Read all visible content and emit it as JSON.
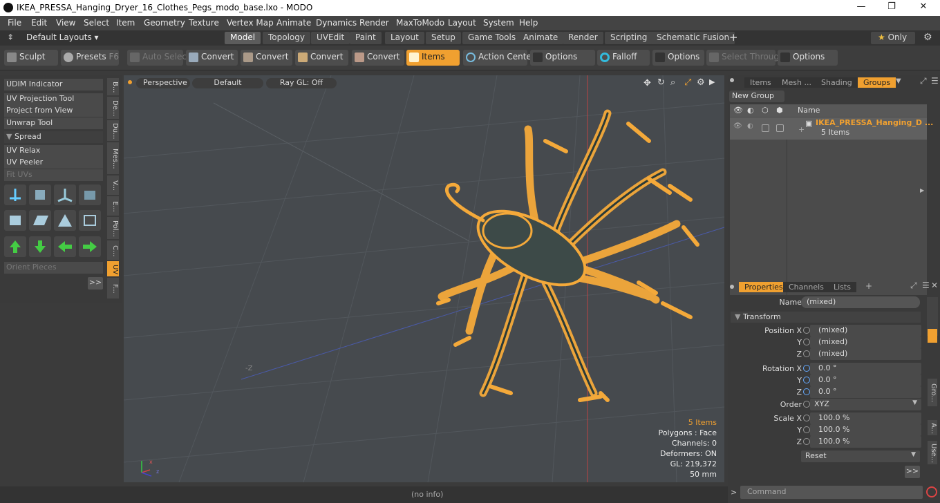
{
  "titlebar": {
    "title": "IKEA_PRESSA_Hanging_Dryer_16_Clothes_Pegs_modo_base.lxo - MODO",
    "minimize": "—",
    "maximize": "❐",
    "close": "✕"
  },
  "menu": [
    "File",
    "Edit",
    "View",
    "Select",
    "Item",
    "Geometry",
    "Texture",
    "Vertex Map",
    "Animate",
    "Dynamics",
    "Render",
    "MaxToModo",
    "Layout",
    "System",
    "Help"
  ],
  "layouts": {
    "default": "Default Layouts ▾",
    "tabs": [
      "Model",
      "Topology",
      "UVEdit",
      "Paint",
      "Layout",
      "Setup",
      "Game Tools",
      "Animate",
      "Render",
      "Scripting",
      "Schematic Fusion"
    ],
    "add": "+",
    "only": "Only"
  },
  "toolbar": {
    "sculpt": "Sculpt",
    "presets": "Presets",
    "presets_key": "F6",
    "auto_select": "Auto Select",
    "convert": "Convert",
    "items": "Items",
    "action_center": "Action Center",
    "options": "Options",
    "falloff": "Falloff",
    "select_through": "Select Through"
  },
  "left": {
    "buttons": [
      "UDIM Indicator",
      "UV Projection Tool",
      "Project from View",
      "Unwrap Tool"
    ],
    "spread": "Spread",
    "buttons2": [
      "UV Relax",
      "UV Peeler",
      "Fit UVs"
    ],
    "orient": "Orient Pieces",
    "more": ">>",
    "vtabs": [
      "B...",
      "De...",
      "Du...",
      "Mes...",
      "V...",
      "E...",
      "Pol...",
      "C...",
      "UV",
      "F..."
    ]
  },
  "viewport": {
    "perspective": "Perspective",
    "default": "Default",
    "raygl": "Ray GL: Off",
    "info": [
      "5 Items",
      "Polygons : Face",
      "Channels: 0",
      "Deformers: ON",
      "GL: 219,372",
      "50 mm"
    ],
    "axis_label": "-Z"
  },
  "right": {
    "tabs": [
      "Items",
      "Mesh ...",
      "Shading",
      "Groups"
    ],
    "new_group": "New Group",
    "name_col": "Name",
    "group_name": "IKEA_PRESSA_Hanging_D ...",
    "group_count": "5 Items",
    "ptabs": [
      "Properties",
      "Channels",
      "Lists"
    ],
    "props": {
      "name_label": "Name",
      "name_value": "(mixed)",
      "transform": "Transform",
      "position_label": "Position X",
      "y": "Y",
      "z": "Z",
      "pos": [
        "(mixed)",
        "(mixed)",
        "(mixed)"
      ],
      "rotation_label": "Rotation X",
      "rot": [
        "0.0 °",
        "0.0 °",
        "0.0 °"
      ],
      "order_label": "Order",
      "order": "XYZ",
      "scale_label": "Scale X",
      "scale": [
        "100.0 %",
        "100.0 %",
        "100.0 %"
      ],
      "reset": "Reset",
      "more": ">>"
    },
    "side_tabs": [
      "Gro...",
      "A...",
      "Use..."
    ]
  },
  "status": {
    "info": "(no info)",
    "command": "Command"
  },
  "colors": {
    "accent": "#f0a030",
    "viewport": "#464a4e"
  }
}
